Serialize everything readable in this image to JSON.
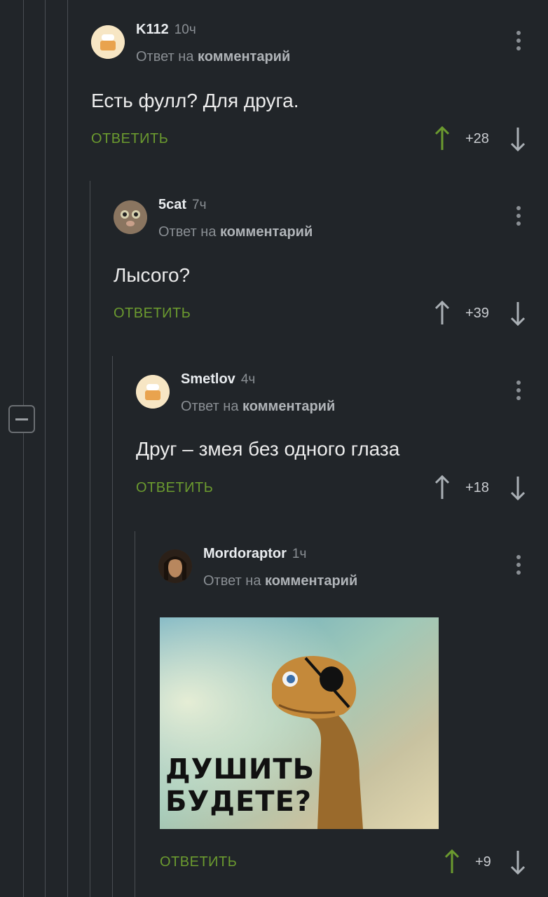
{
  "comments": [
    {
      "author": "K112",
      "time": "10ч",
      "reply_prefix": "Ответ на",
      "reply_link": "комментарий",
      "text": "Есть фулл? Для друга.",
      "reply_label": "ОТВЕТИТЬ",
      "score": "+28",
      "vote": "up"
    },
    {
      "author": "5cat",
      "time": "7ч",
      "reply_prefix": "Ответ на",
      "reply_link": "комментарий",
      "text": "Лысого?",
      "reply_label": "ОТВЕТИТЬ",
      "score": "+39",
      "vote": "none"
    },
    {
      "author": "Smetlov",
      "time": "4ч",
      "reply_prefix": "Ответ на",
      "reply_link": "комментарий",
      "text": "Друг – змея без одного глаза",
      "reply_label": "ОТВЕТИТЬ",
      "score": "+18",
      "vote": "none"
    },
    {
      "author": "Mordoraptor",
      "time": "1ч",
      "reply_prefix": "Ответ на",
      "reply_link": "комментарий",
      "image_caption": "ДУШИТЬ БУДЕТЕ?",
      "reply_label": "ОТВЕТИТЬ",
      "score": "+9",
      "vote": "up"
    }
  ],
  "image_text": {
    "line1": "ДУШИТЬ",
    "line2": "БУДЕТЕ?"
  },
  "colors": {
    "background": "#212529",
    "accent_green": "#6b9a2f",
    "muted": "#8a8f94"
  }
}
